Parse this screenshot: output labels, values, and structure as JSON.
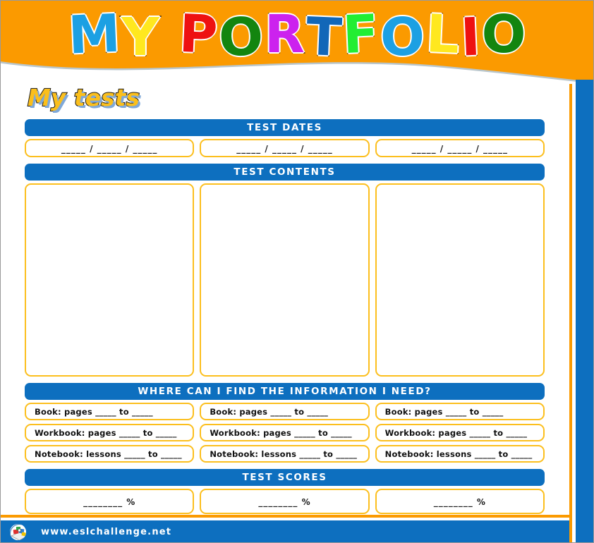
{
  "colors": {
    "orange": "#fb9a00",
    "blue": "#0d6fbf",
    "gold_border": "#fcbf1e",
    "heading_yellow": "#fbbf1c",
    "white": "#ffffff"
  },
  "header": {
    "title_line1": "MY",
    "title_line2": "PORTFOLIO",
    "title_letters": [
      {
        "char": "M",
        "color": "#1ca0e3"
      },
      {
        "char": "Y",
        "color": "#ffe81f"
      },
      {
        "char": "P",
        "color": "#ee1111"
      },
      {
        "char": "O",
        "color": "#13850f"
      },
      {
        "char": "R",
        "color": "#cc22ee"
      },
      {
        "char": "T",
        "color": "#1267b8"
      },
      {
        "char": "F",
        "color": "#22ee33"
      },
      {
        "char": "O",
        "color": "#1ca0e3"
      },
      {
        "char": "L",
        "color": "#ffe81f"
      },
      {
        "char": "I",
        "color": "#ee1111"
      },
      {
        "char": "O",
        "color": "#13850f"
      }
    ]
  },
  "page_heading": "My tests",
  "sections": {
    "test_dates": {
      "bar_label": "TEST DATES",
      "values": [
        "_____ / _____ / _____",
        "_____ / _____ / _____",
        "_____ / _____ / _____"
      ]
    },
    "test_contents": {
      "bar_label": "TEST CONTENTS",
      "values": [
        "",
        "",
        ""
      ]
    },
    "where_find": {
      "bar_label": "WHERE CAN I FIND THE INFORMATION I NEED?",
      "rows": [
        {
          "values": [
            "Book: pages _____ to _____",
            "Book: pages _____ to _____",
            "Book: pages _____ to _____"
          ]
        },
        {
          "values": [
            "Workbook: pages _____ to _____",
            "Workbook: pages _____ to _____",
            "Workbook: pages _____ to _____"
          ]
        },
        {
          "values": [
            "Notebook: lessons _____ to _____",
            "Notebook: lessons _____ to _____",
            "Notebook: lessons _____ to _____"
          ]
        }
      ]
    },
    "test_scores": {
      "bar_label": "TEST SCORES",
      "values": [
        "________ %",
        "________ %",
        "________ %"
      ]
    }
  },
  "footer": {
    "url": "www.eslchallenge.net",
    "logo_name": "esl-challenge-logo"
  }
}
